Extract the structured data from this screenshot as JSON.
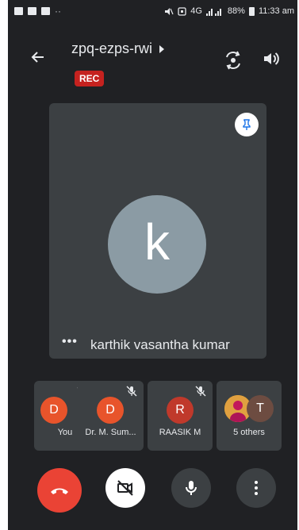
{
  "status_bar": {
    "network": "4G",
    "battery": "88%",
    "time": "11:33 am"
  },
  "header": {
    "meeting_code": "zpq-ezps-rwi",
    "recording_badge": "REC"
  },
  "main_tile": {
    "avatar_initial": "k",
    "avatar_color": "#8b9ba4",
    "participant_name": "karthik vasantha kumar"
  },
  "participants": [
    {
      "initial": "D",
      "label": "You",
      "avatar_color": "#e8542b",
      "muted": false,
      "has_menu": true
    },
    {
      "initial": "D",
      "label": "Dr. M. Sum...",
      "avatar_color": "#e8542b",
      "muted": true
    },
    {
      "initial": "R",
      "label": "RAASIK M",
      "avatar_color": "#c0392b",
      "muted": true
    },
    {
      "initial": "T",
      "label": "5 others",
      "avatar_color": "#6d4c41",
      "muted": false
    }
  ],
  "controls": {
    "end_call_color": "#ea4335",
    "camera_off_bg": "#ffffff",
    "icons": [
      "end-call-icon",
      "camera-off-icon",
      "mic-icon",
      "more-vert-icon"
    ]
  }
}
